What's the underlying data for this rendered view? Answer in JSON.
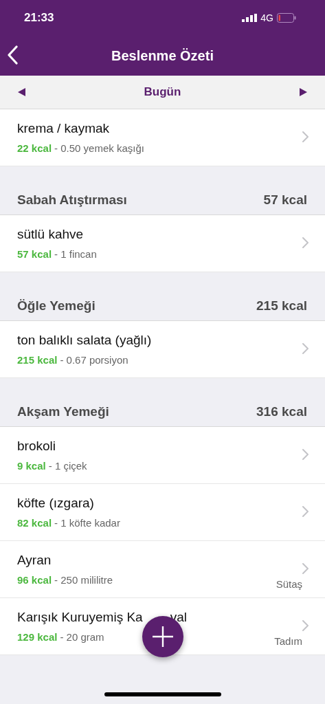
{
  "status_bar": {
    "time": "21:33",
    "network": "4G"
  },
  "nav": {
    "title": "Beslenme Özeti"
  },
  "date_bar": {
    "label": "Bugün"
  },
  "sections": [
    {
      "items": [
        {
          "name": "krema / kaymak",
          "kcal": "22 kcal",
          "amount": "- 0.50 yemek kaşığı"
        }
      ]
    },
    {
      "title": "Sabah Atıştırması",
      "total": "57 kcal",
      "items": [
        {
          "name": "sütlü kahve",
          "kcal": "57 kcal",
          "amount": "- 1 fincan"
        }
      ]
    },
    {
      "title": "Öğle Yemeği",
      "total": "215 kcal",
      "items": [
        {
          "name": "ton balıklı salata (yağlı)",
          "kcal": "215 kcal",
          "amount": "- 0.67 porsiyon"
        }
      ]
    },
    {
      "title": "Akşam Yemeği",
      "total": "316 kcal",
      "items": [
        {
          "name": "brokoli",
          "kcal": "9 kcal",
          "amount": "- 1 çiçek"
        },
        {
          "name": "köfte (ızgara)",
          "kcal": "82 kcal",
          "amount": "- 1 köfte kadar"
        },
        {
          "name": "Ayran",
          "kcal": "96 kcal",
          "amount": "- 250 mililitre",
          "brand": "Sütaş"
        },
        {
          "name": "Karışık Kuruyemiş Ka",
          "name_end": "val",
          "kcal": "129 kcal",
          "amount": "- 20 gram",
          "brand": "Tadım"
        }
      ]
    }
  ]
}
